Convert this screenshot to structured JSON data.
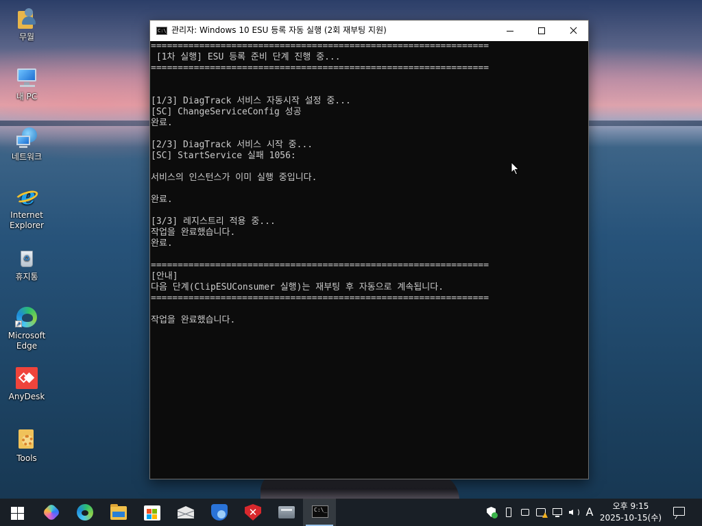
{
  "desktop": {
    "icons": [
      {
        "label": "무월",
        "icon": "user-folder-icon"
      },
      {
        "label": "내 PC",
        "icon": "computer-icon"
      },
      {
        "label": "네트워크",
        "icon": "network-icon"
      },
      {
        "label": "Internet Explorer",
        "icon": "internet-explorer-icon"
      },
      {
        "label": "휴지통",
        "icon": "recycle-bin-icon"
      },
      {
        "label": "Microsoft Edge",
        "icon": "edge-icon"
      },
      {
        "label": "AnyDesk",
        "icon": "anydesk-icon"
      },
      {
        "label": "Tools",
        "icon": "tools-icon"
      }
    ]
  },
  "window": {
    "title": "관리자:  Windows 10 ESU 등록 자동 실행 (2회 재부팅 지원)",
    "icon_text": "C:\\_",
    "controls": {
      "minimize": "minimize",
      "maximize": "maximize",
      "close": "close"
    }
  },
  "console": {
    "lines": [
      "===============================================================",
      " [1차 실행] ESU 등록 준비 단계 진행 중...",
      "===============================================================",
      "",
      "",
      "[1/3] DiagTrack 서비스 자동시작 설정 중...",
      "[SC] ChangeServiceConfig 성공",
      "완료.",
      "",
      "[2/3] DiagTrack 서비스 시작 중...",
      "[SC] StartService 실패 1056:",
      "",
      "서비스의 인스턴스가 이미 실행 중입니다.",
      "",
      "완료.",
      "",
      "[3/3] 레지스트리 적용 중...",
      "작업을 완료했습니다.",
      "완료.",
      "",
      "===============================================================",
      "[안내]",
      "다음 단계(ClipESUConsumer 실행)는 재부팅 후 자동으로 계속됩니다.",
      "===============================================================",
      "",
      "작업을 완료했습니다.",
      ""
    ]
  },
  "taskbar": {
    "apps": [
      {
        "name": "start",
        "icon": "windows-start-icon"
      },
      {
        "name": "copilot",
        "icon": "copilot-icon"
      },
      {
        "name": "edge",
        "icon": "edge-icon"
      },
      {
        "name": "file-explorer",
        "icon": "folder-icon"
      },
      {
        "name": "store",
        "icon": "store-icon"
      },
      {
        "name": "mail",
        "icon": "mail-icon"
      },
      {
        "name": "shield",
        "icon": "shield-icon"
      },
      {
        "name": "security",
        "icon": "security-icon"
      },
      {
        "name": "virtual-machine",
        "icon": "vm-icon"
      },
      {
        "name": "command-prompt",
        "icon": "console-icon",
        "active": true,
        "icon_text": "C:\\_"
      }
    ],
    "tray": {
      "ime": "A",
      "time": "오후 9:15",
      "date": "2025-10-15(수)"
    }
  },
  "colors": {
    "console_bg": "#0c0c0c",
    "console_text": "#cccccc",
    "titlebar_bg": "#ffffff",
    "taskbar_bg": "#1a1e24"
  }
}
